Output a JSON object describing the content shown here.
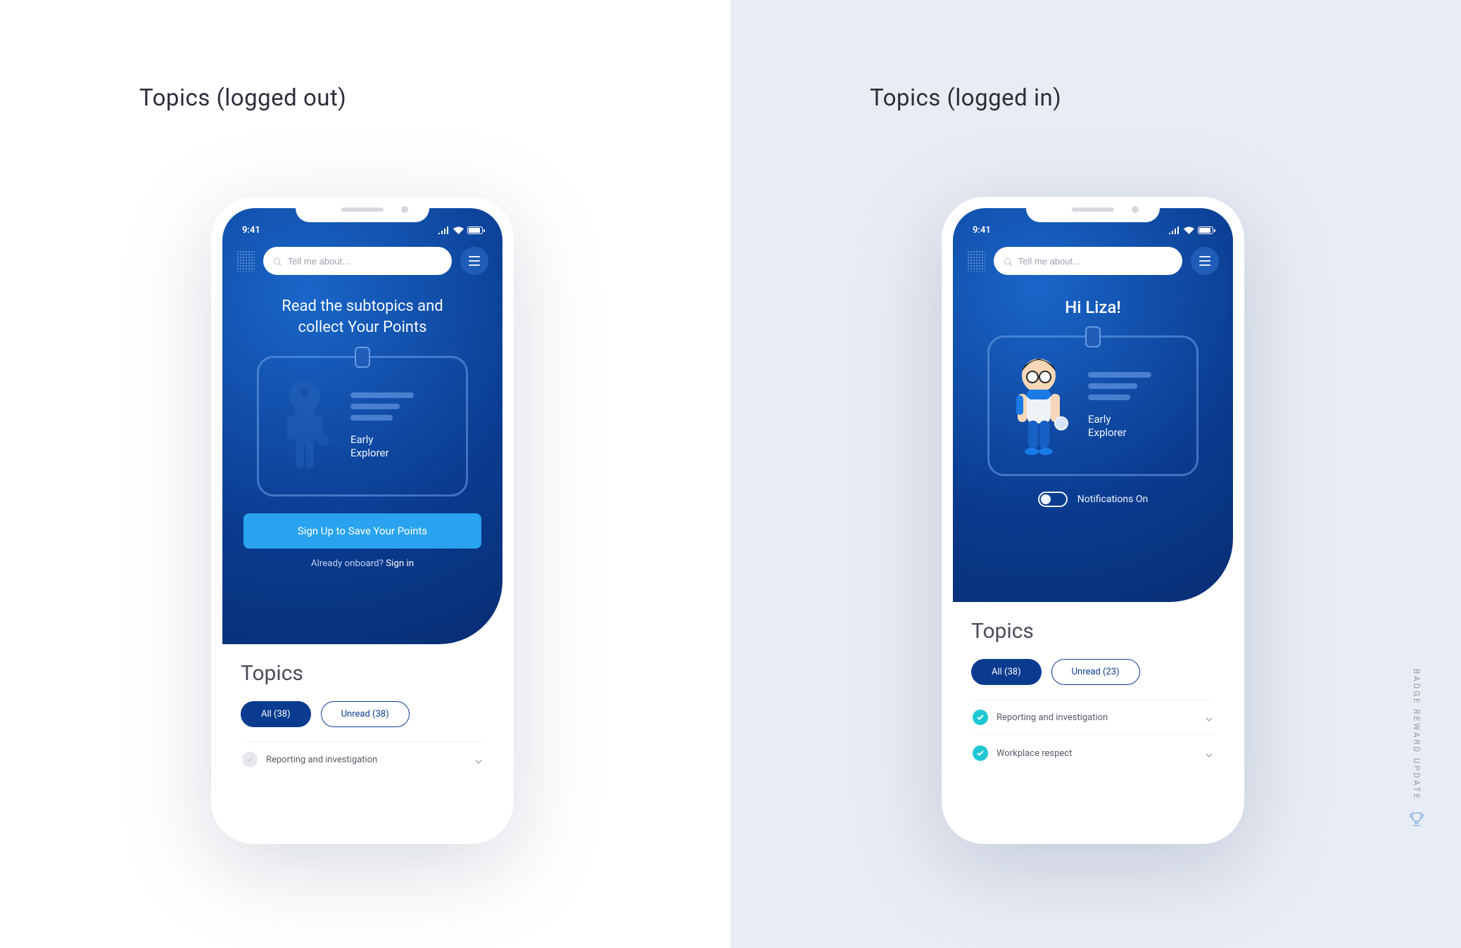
{
  "panels": {
    "left_title": "Topics (logged out)",
    "right_title": "Topics (logged in)"
  },
  "status": {
    "time": "9:41"
  },
  "search": {
    "placeholder": "Tell me about..."
  },
  "logged_out": {
    "hero_line1": "Read the subtopics and",
    "hero_line2": "collect Your Points",
    "badge_label_l1": "Early",
    "badge_label_l2": "Explorer",
    "cta": "Sign Up to Save Your Points",
    "under_cta_text": "Already onboard? ",
    "under_cta_link": "Sign in",
    "topics_heading": "Topics",
    "pill_all": "All (38)",
    "pill_unread": "Unread (38)",
    "rows": [
      {
        "label": "Reporting and investigation",
        "status": "grey"
      }
    ]
  },
  "logged_in": {
    "greeting": "Hi Liza!",
    "badge_label_l1": "Early",
    "badge_label_l2": "Explorer",
    "notif_label": "Notifications On",
    "topics_heading": "Topics",
    "pill_all": "All (38)",
    "pill_unread": "Unread (23)",
    "rows": [
      {
        "label": "Reporting and investigation",
        "status": "teal"
      },
      {
        "label": "Workplace respect",
        "status": "teal"
      }
    ]
  },
  "side_label": "BADGE REWARD UPDATE"
}
